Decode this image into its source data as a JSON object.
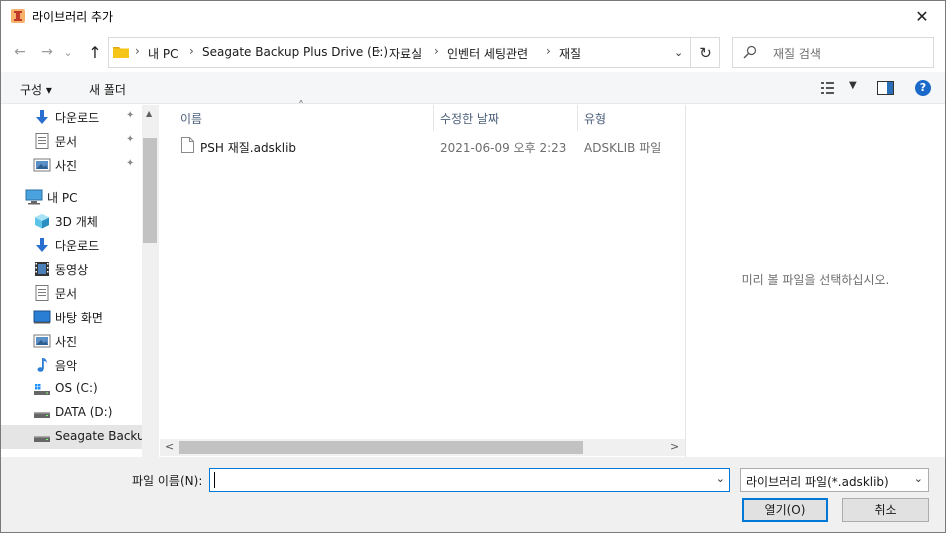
{
  "window": {
    "title": "라이브러리 추가",
    "close_glyph": "✕"
  },
  "nav": {
    "back_glyph": "←",
    "forward_glyph": "→",
    "recent_glyph": "⌄",
    "up_glyph": "↑",
    "breadcrumbs": [
      "내 PC",
      "Seagate Backup Plus Drive (E:)",
      "자료실",
      "인벤터 세팅관련",
      "재질"
    ],
    "refresh_glyph": "↻",
    "search_placeholder": "재질 검색"
  },
  "toolbar": {
    "organize_label": "구성 ▾",
    "new_folder_label": "새 폴더",
    "help_glyph": "?"
  },
  "sidebar": {
    "items": [
      {
        "label": "다운로드",
        "icon": "download-icon",
        "pinned": true
      },
      {
        "label": "문서",
        "icon": "document-icon",
        "pinned": true
      },
      {
        "label": "사진",
        "icon": "pictures-icon",
        "pinned": true
      },
      {
        "label": "내 PC",
        "icon": "pc-icon",
        "pinned": false
      },
      {
        "label": "3D 개체",
        "icon": "3d-objects-icon",
        "pinned": false
      },
      {
        "label": "다운로드",
        "icon": "download-icon",
        "pinned": false
      },
      {
        "label": "동영상",
        "icon": "videos-icon",
        "pinned": false
      },
      {
        "label": "문서",
        "icon": "document-icon",
        "pinned": false
      },
      {
        "label": "바탕 화면",
        "icon": "desktop-icon",
        "pinned": false
      },
      {
        "label": "사진",
        "icon": "pictures-icon",
        "pinned": false
      },
      {
        "label": "음악",
        "icon": "music-icon",
        "pinned": false
      },
      {
        "label": "OS (C:)",
        "icon": "os-drive-icon",
        "pinned": false
      },
      {
        "label": "DATA (D:)",
        "icon": "drive-icon",
        "pinned": false
      },
      {
        "label": "Seagate Backup",
        "icon": "drive-icon",
        "pinned": false,
        "selected": true
      }
    ],
    "pin_glyph": "📌"
  },
  "file_list": {
    "columns": [
      "이름",
      "수정한 날짜",
      "유형"
    ],
    "sort_glyph": "˄",
    "rows": [
      {
        "name": "PSH 재질.adsklib",
        "modified": "2021-06-09 오후 2:23",
        "type": "ADSKLIB 파일"
      }
    ],
    "scroll_left_glyph": "<",
    "scroll_right_glyph": ">"
  },
  "preview": {
    "message": "미리 볼 파일을 선택하십시오."
  },
  "footer": {
    "filename_label": "파일 이름(N):",
    "filename_value": "",
    "filter_value": "라이브러리 파일(*.adsklib)",
    "open_label": "열기(O)",
    "cancel_label": "취소"
  },
  "colors": {
    "accent": "#0078d7",
    "folder": "#f5c518",
    "help": "#1b6ac9"
  }
}
